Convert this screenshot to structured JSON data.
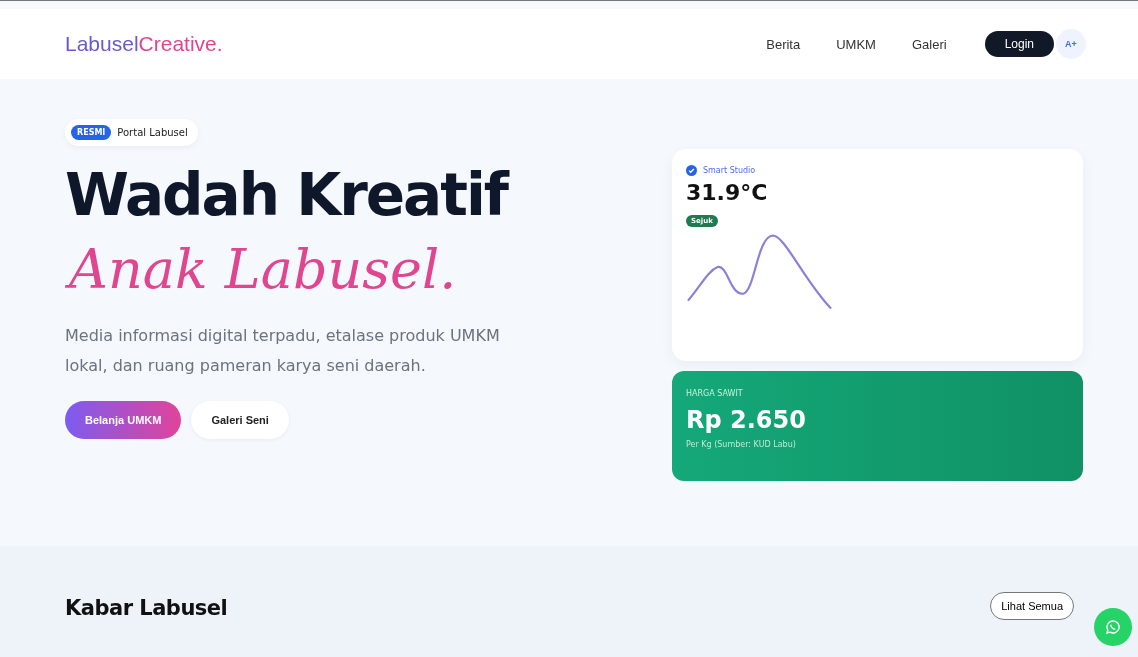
{
  "nav": {
    "logo_main": "Labusel",
    "logo_accent": "Creative.",
    "links": [
      "Berita",
      "UMKM",
      "Galeri"
    ],
    "login": "Login",
    "font_toggle": "A+"
  },
  "hero": {
    "badge_tag": "RESMI",
    "badge_text": "Portal Labusel",
    "title_line1": "Wadah Kreatif",
    "title_line2": "Anak Labusel.",
    "description": "Media informasi digital terpadu, etalase produk UMKM lokal, dan ruang pameran karya seni daerah.",
    "buttons": [
      {
        "label": "Belanja UMKM",
        "kind": "primary"
      },
      {
        "label": "Galeri Seni",
        "kind": "secondary"
      }
    ]
  },
  "weather_card": {
    "label": "Smart Studio",
    "temperature": "31.9°C",
    "status": "Sejuk"
  },
  "price_card": {
    "label": "HARGA SAWIT",
    "price": "Rp 2.650",
    "note": "Per Kg (Sumber: KUD Labu)"
  },
  "news": {
    "title": "Kabar Labusel",
    "see_all": "Lihat Semua"
  }
}
